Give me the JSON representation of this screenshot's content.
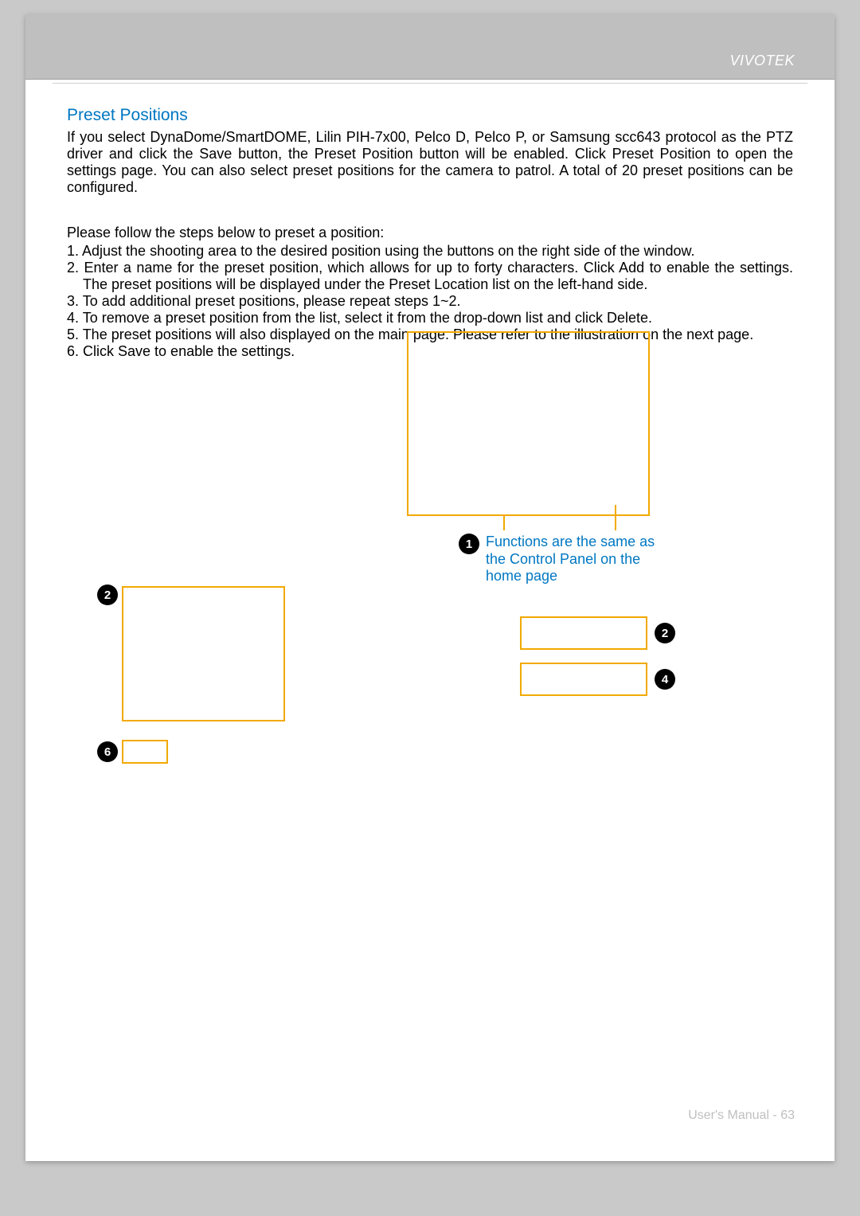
{
  "brand": "VIVOTEK",
  "section_title": "Preset Positions",
  "intro_paragraph": "If you select DynaDome/SmartDOME, Lilin PIH-7x00, Pelco D, Pelco P, or Samsung scc643 protocol as the PTZ driver and click the Save button, the Preset Position button will be enabled. Click Preset Position  to open the settings page. You can also select preset positions for the camera to patrol. A total of 20 preset positions can be configured.",
  "steps_intro": "Please follow the steps below to preset a position:",
  "steps": [
    "1. Adjust the shooting area to the desired position using the buttons on the right side of the window.",
    "2. Enter a name for the preset position, which allows for up to forty characters. Click Add to enable the settings. The preset positions will be displayed under the Preset Location list on the left-hand side.",
    "3. To add additional preset positions, please repeat steps 1~2.",
    "4. To remove a preset position from the list, select it from the drop-down list and click Delete.",
    "5. The preset positions will also displayed on the main page. Please refer to the illustration on the next page.",
    "6. Click Save to enable the settings."
  ],
  "callouts": {
    "c1": {
      "num": "1",
      "text": "Functions are the same as the Control Panel on the home page"
    },
    "c2a": {
      "num": "2"
    },
    "c2b": {
      "num": "2"
    },
    "c4": {
      "num": "4"
    },
    "c6": {
      "num": "6"
    }
  },
  "footer": "User's Manual - 63"
}
